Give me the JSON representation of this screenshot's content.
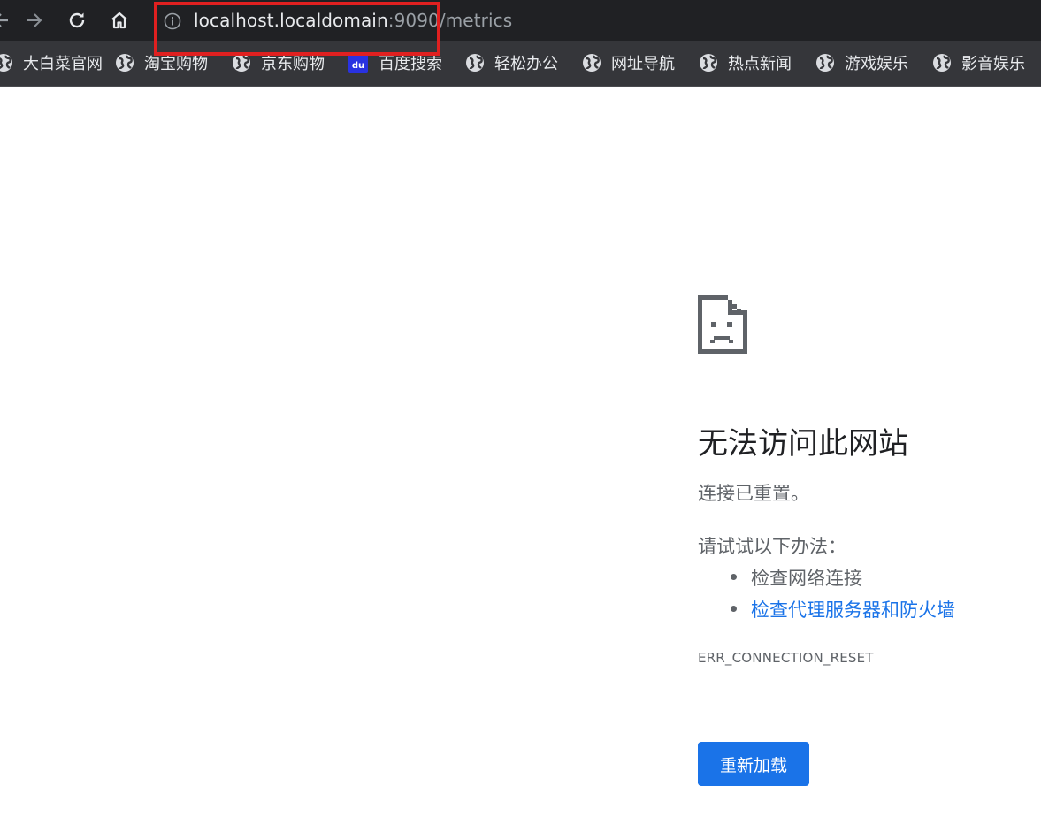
{
  "toolbar": {
    "url_host": "localhost.localdomain",
    "url_rest": ":9090/metrics",
    "icons": [
      "back-arrow-icon",
      "forward-arrow-icon",
      "reload-icon",
      "home-icon",
      "info-icon"
    ]
  },
  "bookmarks": [
    {
      "label": "大白菜官网",
      "icon": "globe-icon"
    },
    {
      "label": "淘宝购物",
      "icon": "globe-icon"
    },
    {
      "label": "京东购物",
      "icon": "globe-icon"
    },
    {
      "label": "百度搜索",
      "icon": "baidu-icon"
    },
    {
      "label": "轻松办公",
      "icon": "globe-icon"
    },
    {
      "label": "网址导航",
      "icon": "globe-icon"
    },
    {
      "label": "热点新闻",
      "icon": "globe-icon"
    },
    {
      "label": "游戏娱乐",
      "icon": "globe-icon"
    },
    {
      "label": "影音娱乐",
      "icon": "globe-icon"
    }
  ],
  "baidu_icon_text": "du",
  "error": {
    "title": "无法访问此网站",
    "subtitle": "连接已重置。",
    "try_label": "请试试以下办法：",
    "suggestions": [
      "检查网络连接",
      "检查代理服务器和防火墙"
    ],
    "code": "ERR_CONNECTION_RESET",
    "reload_label": "重新加载"
  },
  "colors": {
    "toolbar_bg": "#202124",
    "bookmarks_bg": "#35363a",
    "accent": "#1a73e8",
    "highlight": "#e02020"
  }
}
